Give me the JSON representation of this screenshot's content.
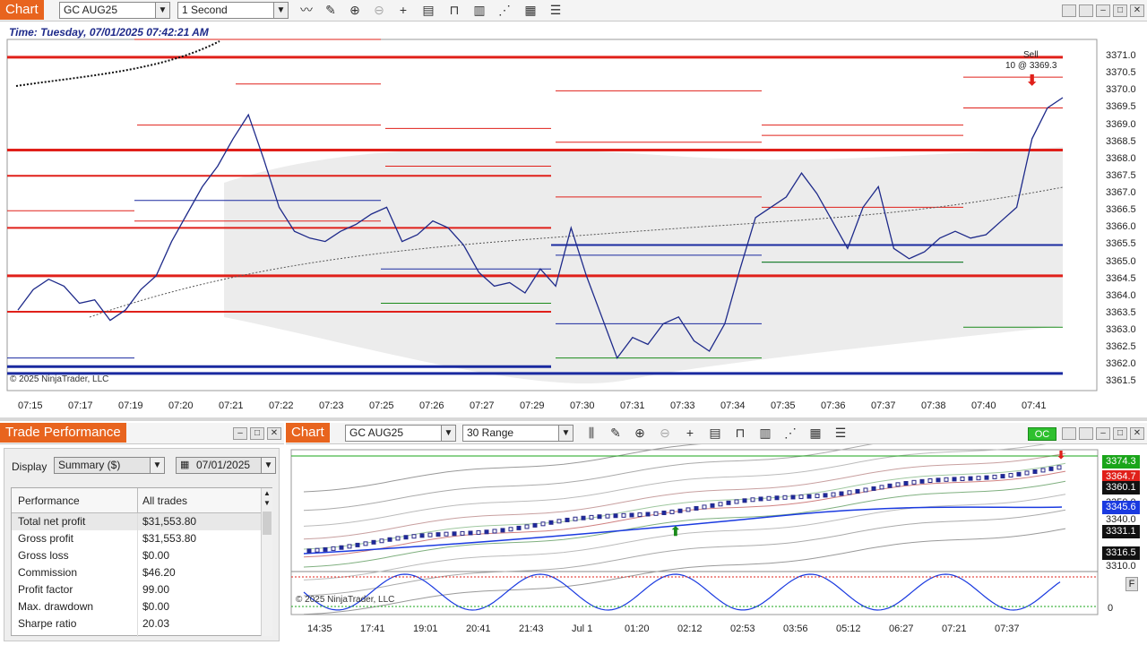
{
  "top_chart": {
    "tab_label": "Chart",
    "instrument": "GC AUG25",
    "interval": "1 Second",
    "time_label": "Time: Tuesday, 07/01/2025 07:42:21 AM",
    "copyright": "© 2025 NinjaTrader, LLC",
    "sell_label": "Sell",
    "sell_detail": "10 @ 3369.3",
    "y_ticks": [
      "3371.0",
      "3370.5",
      "3370.0",
      "3369.5",
      "3369.0",
      "3368.5",
      "3368.0",
      "3367.5",
      "3367.0",
      "3366.5",
      "3366.0",
      "3365.5",
      "3365.0",
      "3364.5",
      "3364.0",
      "3363.5",
      "3363.0",
      "3362.5",
      "3362.0",
      "3361.5"
    ],
    "x_ticks": [
      "07:15",
      "07:17",
      "07:19",
      "07:20",
      "07:21",
      "07:22",
      "07:23",
      "07:25",
      "07:26",
      "07:27",
      "07:29",
      "07:30",
      "07:31",
      "07:33",
      "07:34",
      "07:35",
      "07:36",
      "07:37",
      "07:38",
      "07:40",
      "07:41"
    ],
    "price_range": [
      3361.25,
      3371.5
    ],
    "price_series": [
      3363.6,
      3364.2,
      3364.5,
      3364.3,
      3363.8,
      3363.9,
      3363.3,
      3363.6,
      3364.2,
      3364.6,
      3365.6,
      3366.4,
      3367.2,
      3367.8,
      3368.6,
      3369.3,
      3368.0,
      3366.6,
      3365.9,
      3365.7,
      3365.6,
      3365.9,
      3366.1,
      3366.4,
      3366.6,
      3365.6,
      3365.8,
      3366.2,
      3366.0,
      3365.5,
      3364.7,
      3364.3,
      3364.4,
      3364.1,
      3364.8,
      3364.3,
      3366.0,
      3364.6,
      3363.4,
      3362.2,
      3362.8,
      3362.6,
      3363.2,
      3363.4,
      3362.7,
      3362.4,
      3363.2,
      3364.8,
      3366.3,
      3366.6,
      3366.9,
      3367.6,
      3367.0,
      3366.2,
      3365.4,
      3366.6,
      3367.2,
      3365.4,
      3365.1,
      3365.3,
      3365.7,
      3365.9,
      3365.7,
      3365.8,
      3366.2,
      3366.6,
      3368.6,
      3369.5,
      3369.8
    ]
  },
  "bottom_chart": {
    "tab_label": "Chart",
    "instrument": "GC AUG25",
    "interval": "30 Range",
    "status_badge": "OC",
    "copyright": "© 2025 NinjaTrader, LLC",
    "x_ticks": [
      "14:35",
      "17:41",
      "19:01",
      "20:41",
      "21:43",
      "Jul 1",
      "01:20",
      "02:12",
      "02:53",
      "03:56",
      "05:12",
      "06:27",
      "07:21",
      "07:37"
    ],
    "y_ticks": [
      "3310.0",
      "3340.0",
      "3350.0",
      "3360.0"
    ],
    "oscillator_tick": "0",
    "price_tags": [
      {
        "value": "3374.3",
        "color": "#1aa51a"
      },
      {
        "value": "3364.7",
        "color": "#e0201a"
      },
      {
        "value": "3360.1",
        "color": "#111111"
      },
      {
        "value": "3345.6",
        "color": "#1a3ae0"
      },
      {
        "value": "3331.1",
        "color": "#111111"
      },
      {
        "value": "3316.5",
        "color": "#111111"
      }
    ],
    "f_button": "F"
  },
  "trade_performance": {
    "title": "Trade Performance",
    "display_label": "Display",
    "display_value": "Summary ($)",
    "date_value": "07/01/2025",
    "col_header_1": "Performance",
    "col_header_2": "All trades",
    "rows": [
      {
        "label": "Total net profit",
        "value": "$31,553.80"
      },
      {
        "label": "Gross profit",
        "value": "$31,553.80"
      },
      {
        "label": "Gross loss",
        "value": "$0.00"
      },
      {
        "label": "Commission",
        "value": "$46.20"
      },
      {
        "label": "Profit factor",
        "value": "99.00"
      },
      {
        "label": "Max. drawdown",
        "value": "$0.00"
      },
      {
        "label": "Sharpe ratio",
        "value": "20.03"
      }
    ]
  },
  "colors": {
    "accent_orange": "#e8641e",
    "price_line": "#1e2a8a",
    "resistance": "#e0201a",
    "support": "#1a2aa0"
  }
}
